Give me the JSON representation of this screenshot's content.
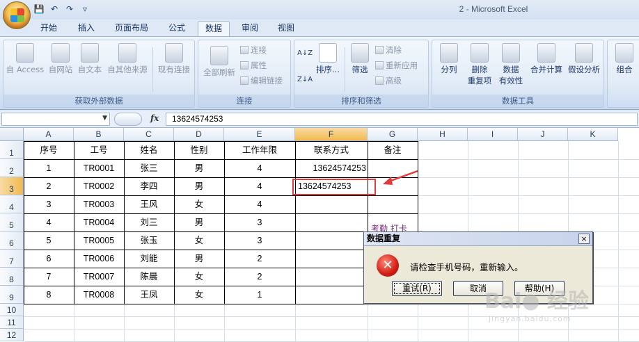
{
  "window": {
    "title": "2 - Microsoft Excel"
  },
  "qat": {
    "save": "💾",
    "undo": "↶",
    "redo": "↷",
    "more": "▿"
  },
  "tabs": [
    {
      "label": "开始"
    },
    {
      "label": "插入"
    },
    {
      "label": "页面布局"
    },
    {
      "label": "公式"
    },
    {
      "label": "数据"
    },
    {
      "label": "审阅"
    },
    {
      "label": "视图"
    }
  ],
  "ribbon": {
    "group1": {
      "label": "获取外部数据",
      "btn1": "自 Access",
      "btn2": "自网站",
      "btn3": "自文本",
      "btn4": "自其他来源",
      "btn5": "现有连接"
    },
    "group2": {
      "label": "连接",
      "refresh": "全部刷新",
      "connections": "连接",
      "properties": "属性",
      "edit_links": "编辑链接"
    },
    "group3": {
      "label": "排序和筛选",
      "sort": "排序...",
      "filter": "筛选",
      "clear": "清除",
      "reapply": "重新应用",
      "advanced": "高级"
    },
    "group4": {
      "label": "数据工具",
      "split": "分列",
      "remove_dup_1": "删除",
      "remove_dup_2": "重复项",
      "validation_1": "数据",
      "validation_2": "有效性",
      "consolidate": "合并计算",
      "whatif": "假设分析"
    },
    "group5": {
      "label": "",
      "group_btn": "组合"
    }
  },
  "formula_bar": {
    "name_box": "",
    "fx": "fx",
    "value": "13624574253"
  },
  "sheet": {
    "columns": [
      "A",
      "B",
      "C",
      "D",
      "E",
      "F",
      "G",
      "H",
      "I",
      "J",
      "K"
    ],
    "rows": [
      "1",
      "2",
      "3",
      "4",
      "5",
      "6",
      "7",
      "8",
      "9",
      "10",
      "11",
      "12"
    ],
    "header": [
      "序号",
      "工号",
      "姓名",
      "性别",
      "工作年限",
      "联系方式",
      "备注"
    ],
    "data": [
      [
        "1",
        "TR0001",
        "张三",
        "男",
        "4",
        "13624574253"
      ],
      [
        "2",
        "TR0002",
        "李四",
        "男",
        "4",
        "13624574253"
      ],
      [
        "3",
        "TR0003",
        "王风",
        "女",
        "4",
        ""
      ],
      [
        "4",
        "TR0004",
        "刘三",
        "男",
        "3",
        ""
      ],
      [
        "5",
        "TR0005",
        "张玉",
        "女",
        "3",
        ""
      ],
      [
        "6",
        "TR0006",
        "刘能",
        "男",
        "2",
        ""
      ],
      [
        "7",
        "TR0007",
        "陈晨",
        "女",
        "2",
        ""
      ],
      [
        "8",
        "TR0008",
        "王凤",
        "女",
        "1",
        ""
      ]
    ],
    "peek_text": "考勤  打卡"
  },
  "dialog": {
    "title": "数据重复",
    "close": "×",
    "icon": "✕",
    "message": "请检查手机号码，重新输入。",
    "retry": "重试(R)",
    "cancel": "取消",
    "help": "帮助(H)"
  },
  "watermark": {
    "brand": "Bai● 经验",
    "url": "jingyan.baidu.com"
  }
}
